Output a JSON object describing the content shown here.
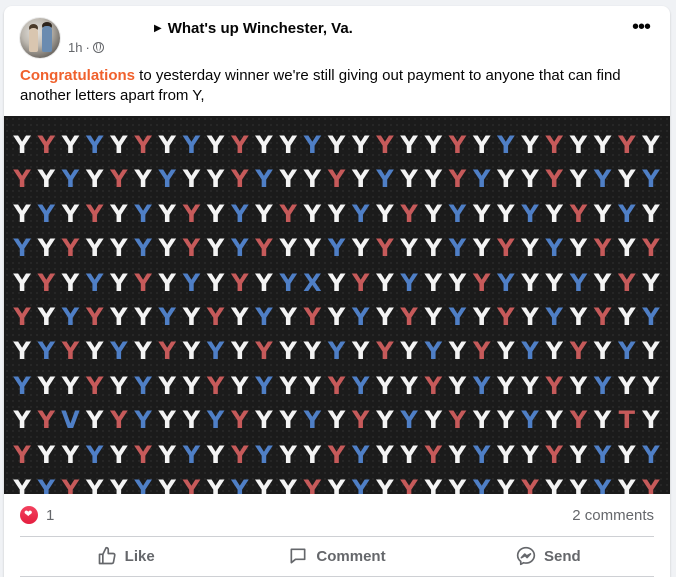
{
  "post": {
    "group_name": "What's up Winchester, Va.",
    "time": "1h",
    "separator": "·",
    "privacy_icon": "globe-icon",
    "more_icon": "more-options-icon",
    "text_highlight": "Congratulations",
    "text_body": " to yesterday winner we're still giving out payment to anyone that can find another letters apart from Y,"
  },
  "puzzle": {
    "colors": {
      "W": "#f4f4f4",
      "R": "#c65a5a",
      "B": "#4f7fc6"
    },
    "rows": [
      [
        "Y:W",
        "Y:R",
        "Y:W",
        "Y:B",
        "Y:W",
        "Y:R",
        "Y:W",
        "Y:B",
        "Y:W",
        "Y:R",
        "Y:W",
        "Y:W",
        "Y:B",
        "Y:W",
        "Y:W",
        "Y:R",
        "Y:W",
        "Y:W",
        "Y:R",
        "Y:W",
        "Y:B",
        "Y:W",
        "Y:R",
        "Y:W",
        "Y:W",
        "Y:R",
        "Y:W"
      ],
      [
        "Y:R",
        "Y:W",
        "Y:B",
        "Y:W",
        "Y:R",
        "Y:W",
        "Y:B",
        "Y:W",
        "Y:W",
        "Y:R",
        "Y:B",
        "Y:W",
        "Y:W",
        "Y:R",
        "Y:W",
        "Y:B",
        "Y:W",
        "Y:W",
        "Y:R",
        "Y:B",
        "Y:W",
        "Y:W",
        "Y:R",
        "Y:W",
        "Y:B",
        "Y:W",
        "Y:B"
      ],
      [
        "Y:W",
        "Y:B",
        "Y:W",
        "Y:R",
        "Y:W",
        "Y:B",
        "Y:W",
        "Y:R",
        "Y:W",
        "Y:B",
        "Y:W",
        "Y:R",
        "Y:W",
        "Y:W",
        "Y:B",
        "Y:W",
        "Y:R",
        "Y:W",
        "Y:B",
        "Y:W",
        "Y:W",
        "Y:B",
        "Y:W",
        "Y:R",
        "Y:W",
        "Y:B",
        "Y:W"
      ],
      [
        "Y:B",
        "Y:W",
        "Y:R",
        "Y:W",
        "Y:W",
        "Y:B",
        "Y:W",
        "Y:R",
        "Y:W",
        "Y:B",
        "Y:R",
        "Y:W",
        "Y:W",
        "Y:B",
        "Y:W",
        "Y:R",
        "Y:W",
        "Y:W",
        "Y:B",
        "Y:W",
        "Y:R",
        "Y:W",
        "Y:B",
        "Y:W",
        "Y:R",
        "Y:W",
        "Y:R"
      ],
      [
        "Y:W",
        "Y:R",
        "Y:W",
        "Y:B",
        "Y:W",
        "Y:R",
        "Y:W",
        "Y:B",
        "Y:W",
        "Y:R",
        "Y:W",
        "Y:B",
        "X:B",
        "Y:W",
        "Y:R",
        "Y:W",
        "Y:B",
        "Y:W",
        "Y:W",
        "Y:R",
        "Y:B",
        "Y:W",
        "Y:W",
        "Y:B",
        "Y:W",
        "Y:R",
        "Y:W"
      ],
      [
        "Y:R",
        "Y:W",
        "Y:B",
        "Y:R",
        "Y:W",
        "Y:W",
        "Y:B",
        "Y:W",
        "Y:R",
        "Y:W",
        "Y:B",
        "Y:W",
        "Y:R",
        "Y:W",
        "Y:B",
        "Y:W",
        "Y:R",
        "Y:W",
        "Y:B",
        "Y:W",
        "Y:R",
        "Y:W",
        "Y:B",
        "Y:W",
        "Y:R",
        "Y:W",
        "Y:B"
      ],
      [
        "Y:W",
        "Y:B",
        "Y:R",
        "Y:W",
        "Y:B",
        "Y:W",
        "Y:R",
        "Y:W",
        "Y:B",
        "Y:W",
        "Y:R",
        "Y:W",
        "Y:W",
        "Y:B",
        "Y:W",
        "Y:R",
        "Y:W",
        "Y:B",
        "Y:W",
        "Y:R",
        "Y:W",
        "Y:B",
        "Y:W",
        "Y:R",
        "Y:W",
        "Y:B",
        "Y:W"
      ],
      [
        "Y:B",
        "Y:W",
        "Y:W",
        "Y:R",
        "Y:W",
        "Y:B",
        "Y:W",
        "Y:W",
        "Y:R",
        "Y:W",
        "Y:B",
        "Y:W",
        "Y:W",
        "Y:R",
        "Y:B",
        "Y:W",
        "Y:W",
        "Y:R",
        "Y:W",
        "Y:B",
        "Y:W",
        "Y:W",
        "Y:R",
        "Y:W",
        "Y:B",
        "Y:W",
        "Y:W"
      ],
      [
        "Y:W",
        "Y:R",
        "V:B",
        "Y:W",
        "Y:R",
        "Y:B",
        "Y:W",
        "Y:W",
        "Y:B",
        "Y:R",
        "Y:W",
        "Y:W",
        "Y:B",
        "Y:W",
        "Y:R",
        "Y:W",
        "Y:B",
        "Y:W",
        "Y:R",
        "Y:W",
        "Y:W",
        "Y:B",
        "Y:W",
        "Y:R",
        "Y:W",
        "T:R",
        "Y:W"
      ],
      [
        "Y:R",
        "Y:W",
        "Y:W",
        "Y:B",
        "Y:W",
        "Y:R",
        "Y:W",
        "Y:B",
        "Y:W",
        "Y:R",
        "Y:B",
        "Y:W",
        "Y:W",
        "Y:R",
        "Y:B",
        "Y:W",
        "Y:W",
        "Y:R",
        "Y:W",
        "Y:B",
        "Y:W",
        "Y:W",
        "Y:R",
        "Y:W",
        "Y:B",
        "Y:W",
        "Y:B"
      ],
      [
        "Y:W",
        "Y:B",
        "Y:R",
        "Y:W",
        "Y:W",
        "Y:B",
        "Y:W",
        "Y:R",
        "Y:W",
        "Y:B",
        "Y:W",
        "Y:W",
        "Y:R",
        "Y:W",
        "Y:B",
        "Y:W",
        "Y:R",
        "Y:W",
        "Y:W",
        "Y:B",
        "Y:W",
        "Y:R",
        "Y:W",
        "Y:W",
        "Y:B",
        "Y:W",
        "Y:R"
      ]
    ]
  },
  "reactions": {
    "icon": "love-reaction-icon",
    "count": "1",
    "comments": "2 comments"
  },
  "actions": {
    "like": "Like",
    "comment": "Comment",
    "send": "Send"
  }
}
